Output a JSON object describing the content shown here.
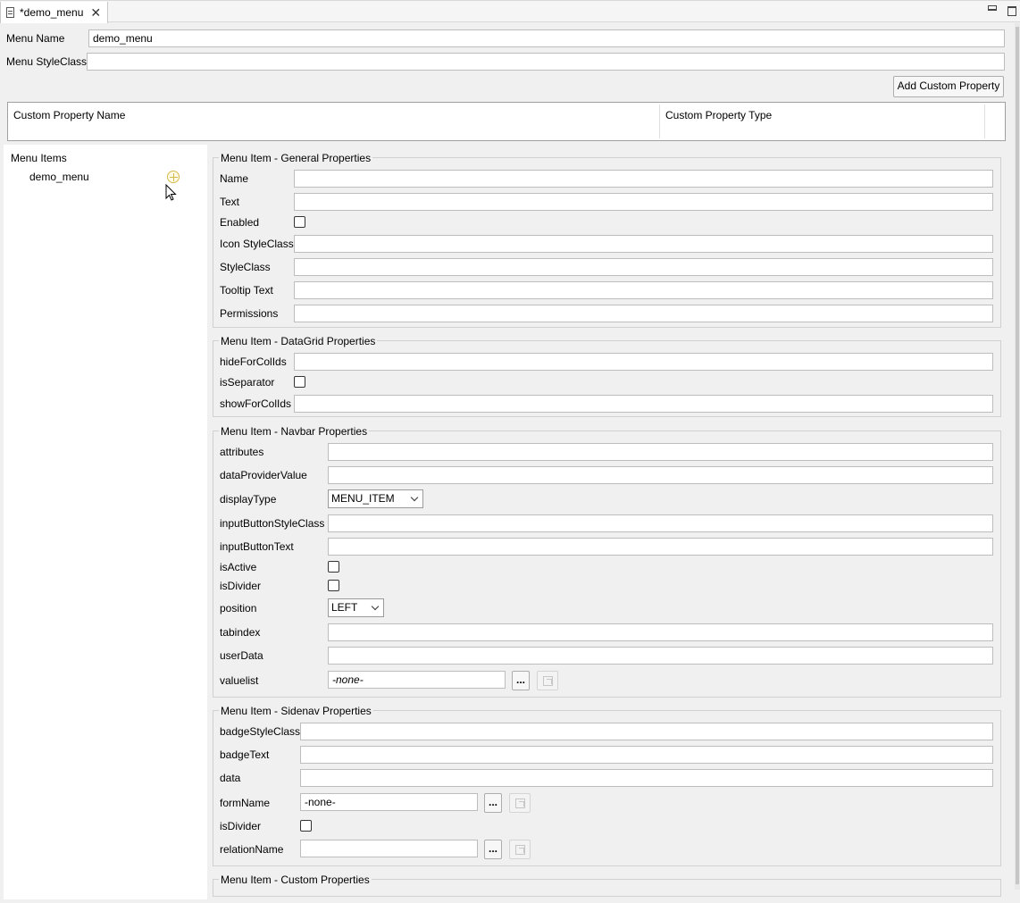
{
  "tab": {
    "title": "*demo_menu"
  },
  "menu": {
    "name_label": "Menu Name",
    "name_value": "demo_menu",
    "styleclass_label": "Menu StyleClass",
    "styleclass_value": "",
    "add_custom_property": "Add Custom Property"
  },
  "custom_table": {
    "col_name": "Custom Property Name",
    "col_type": "Custom Property Type"
  },
  "tree": {
    "title": "Menu Items",
    "item": "demo_menu"
  },
  "general": {
    "title": "Menu Item - General Properties",
    "name": "Name",
    "text": "Text",
    "enabled": "Enabled",
    "icon_styleclass": "Icon StyleClass",
    "styleclass": "StyleClass",
    "tooltip": "Tooltip Text",
    "permissions": "Permissions"
  },
  "datagrid": {
    "title": "Menu Item - DataGrid Properties",
    "hide": "hideForColIds",
    "separator": "isSeparator",
    "show": "showForColIds"
  },
  "navbar": {
    "title": "Menu Item - Navbar Properties",
    "attributes": "attributes",
    "dataprovider": "dataProviderValue",
    "displaytype": "displayType",
    "displaytype_value": "MENU_ITEM",
    "inputbtn_style": "inputButtonStyleClass",
    "inputbtn_text": "inputButtonText",
    "isactive": "isActive",
    "isdivider": "isDivider",
    "position": "position",
    "position_value": "LEFT",
    "tabindex": "tabindex",
    "userdata": "userData",
    "valuelist": "valuelist",
    "valuelist_value": "-none-",
    "browse": "..."
  },
  "sidenav": {
    "title": "Menu Item - Sidenav Properties",
    "badge_style": "badgeStyleClass",
    "badge_text": "badgeText",
    "data": "data",
    "formname": "formName",
    "formname_value": "-none-",
    "isdivider": "isDivider",
    "relationname": "relationName",
    "browse": "..."
  },
  "custom": {
    "title": "Menu Item - Custom Properties"
  },
  "colors": {
    "background": "#f0f0f0",
    "field_border": "#bdbdbd",
    "add_icon": "#d6b94a"
  }
}
